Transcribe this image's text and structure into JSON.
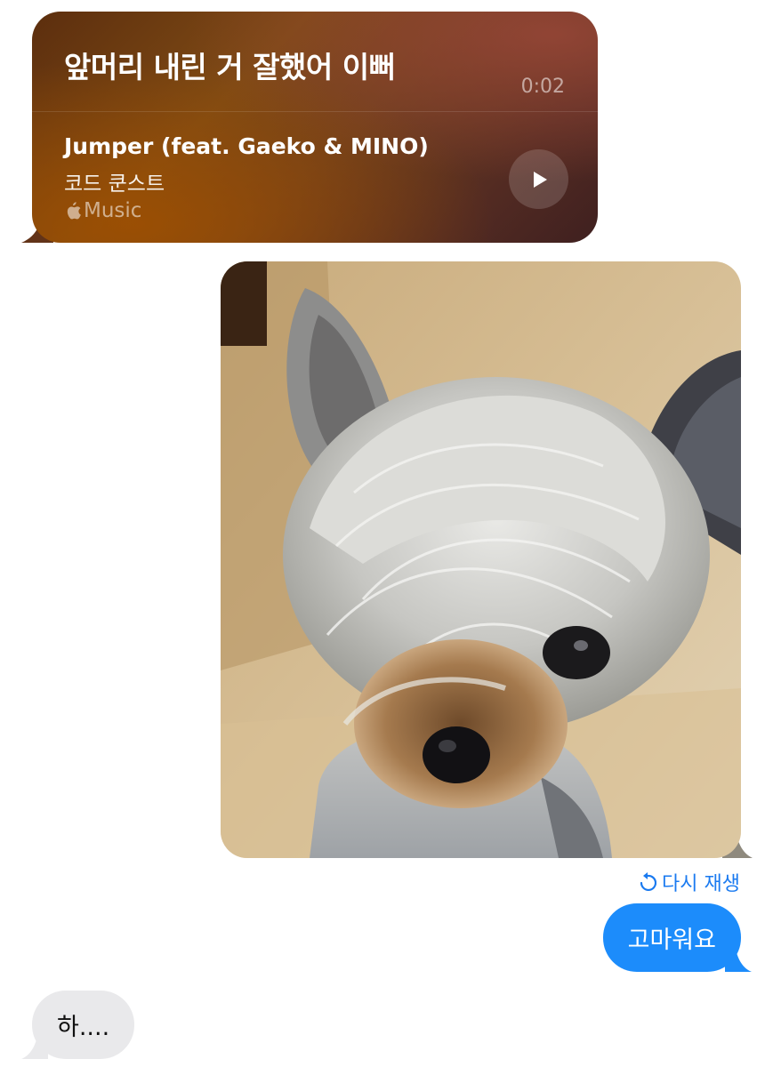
{
  "music_card": {
    "caption": "앞머리 내린 거 잘했어 이뻐",
    "duration": "0:02",
    "song_title": "Jumper (feat. Gaeko & MINO)",
    "artist": "코드 쿤스트",
    "service_label": "Music",
    "service_icon": "apple-icon",
    "play_icon": "play-icon"
  },
  "photo": {
    "alt": "dog photo",
    "subject": "small dog with long grey fringe"
  },
  "replay": {
    "label": "다시 재생",
    "icon": "replay-icon",
    "color": "#1a7af0"
  },
  "messages": [
    {
      "direction": "outgoing",
      "text": "고마워요",
      "color": "#1c8cfb"
    },
    {
      "direction": "incoming",
      "text": "하....",
      "color": "#e9e9eb"
    }
  ]
}
